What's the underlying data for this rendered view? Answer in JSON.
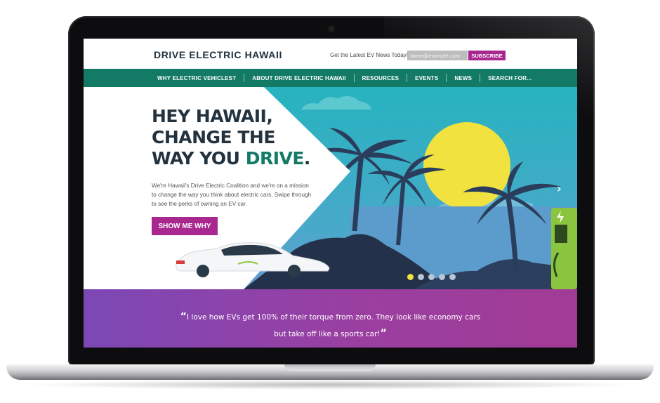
{
  "site": {
    "logo": "DRIVE ELECTRIC HAWAII",
    "newsletter": {
      "label": "Get the Latest EV News Today!",
      "placeholder": "name@example.com",
      "button": "SUBSCRIBE"
    },
    "nav": [
      {
        "label": "WHY ELECTRIC VEHICLES?"
      },
      {
        "label": "ABOUT DRIVE ELECTRIC HAWAII"
      },
      {
        "label": "RESOURCES"
      },
      {
        "label": "EVENTS"
      },
      {
        "label": "NEWS"
      },
      {
        "label": "SEARCH FOR..."
      }
    ]
  },
  "hero": {
    "headline_line1": "HEY HAWAII,",
    "headline_line2": "CHANGE THE",
    "headline_line3_prefix": "WAY YOU ",
    "headline_accent": "DRIVE",
    "headline_suffix": ".",
    "body": "We're Hawaii's Drive Electric Coalition and we're on a mission to change the way you think about electric cars. Swipe through to see the perks of owning an EV car.",
    "cta": "SHOW ME WHY",
    "next_icon": "chevron-right-icon",
    "next_glyph": "›",
    "slides_total": 5,
    "active_slide": 1
  },
  "testimonial": {
    "open_mark": "“",
    "text": "I love how EVs get 100% of their torque from zero. They look like economy cars but take off like a sports car!",
    "close_mark": "”"
  },
  "colors": {
    "brand_navy": "#22323f",
    "brand_green": "#137a66",
    "brand_magenta": "#a8288f",
    "sky_teal": "#2fb7c1",
    "sun_yellow": "#f1e23f",
    "charger_green": "#8bc53f",
    "testimonial_purple": "#7c48b5"
  }
}
